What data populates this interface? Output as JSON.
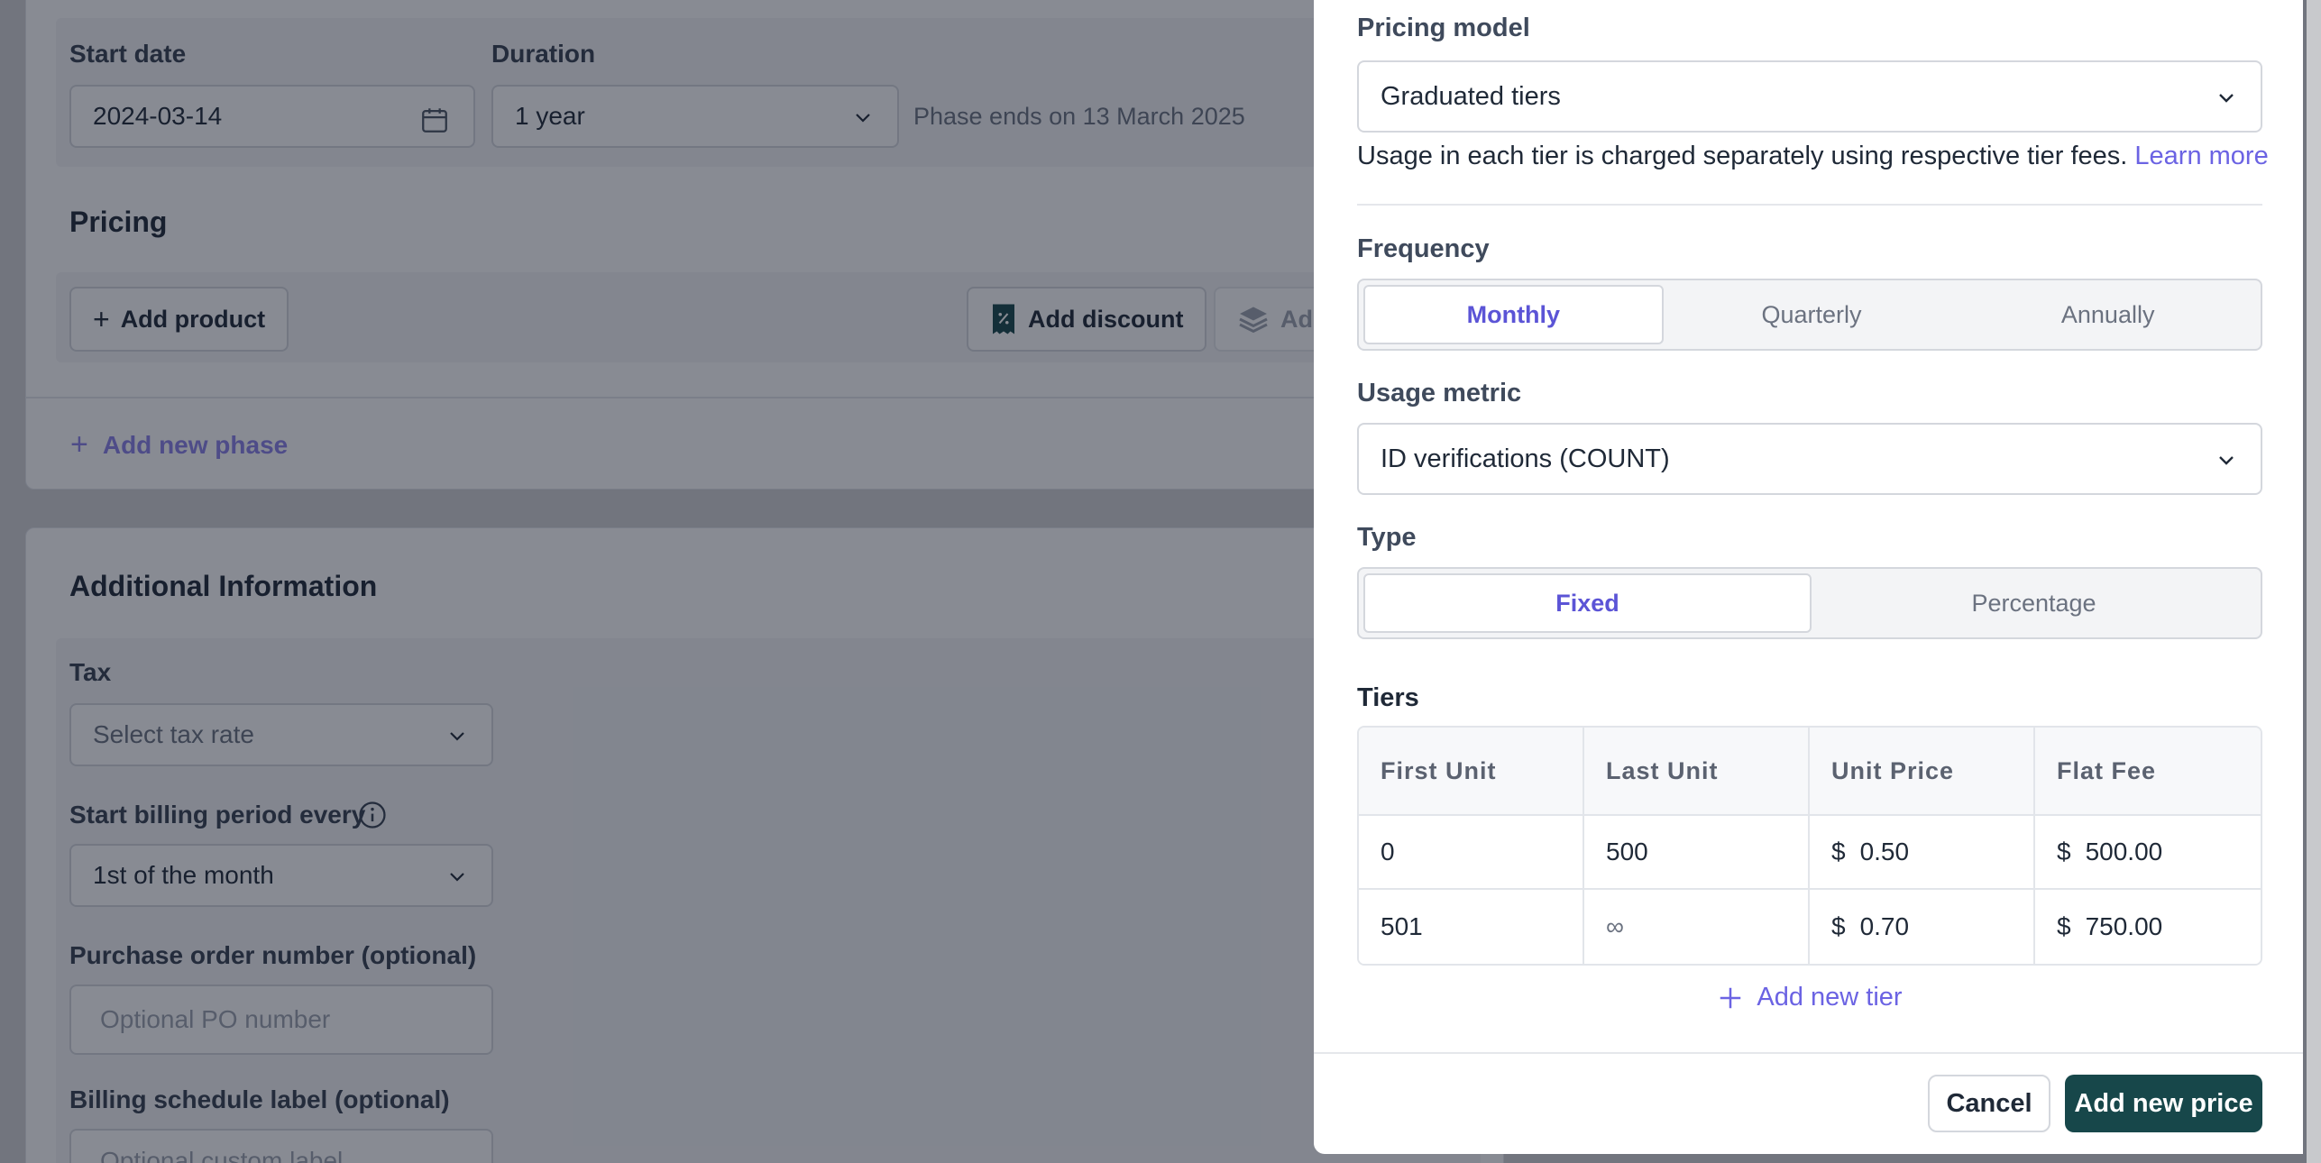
{
  "background": {
    "phase": {
      "start_date_label": "Start date",
      "start_date_value": "2024-03-14",
      "duration_label": "Duration",
      "duration_value": "1 year",
      "phase_end_text": "Phase ends on 13 March 2025"
    },
    "pricing": {
      "title": "Pricing",
      "add_product": "Add product",
      "add_discount": "Add discount",
      "add_other_partial": "Ad"
    },
    "add_new_phase": "Add new phase",
    "additional": {
      "title": "Additional Information",
      "tax_label": "Tax",
      "tax_placeholder": "Select tax rate",
      "billing_period_label": "Start billing period every",
      "billing_period_value": "1st of the month",
      "po_label": "Purchase order number (optional)",
      "po_placeholder": "Optional PO number",
      "schedule_label": "Billing schedule label (optional)",
      "schedule_placeholder": "Optional custom label"
    }
  },
  "drawer": {
    "pricing_model_label": "Pricing model",
    "pricing_model_value": "Graduated tiers",
    "help_text": "Usage in each tier is charged separately using respective tier fees.",
    "learn_more": "Learn more",
    "frequency_label": "Frequency",
    "frequency_options": [
      "Monthly",
      "Quarterly",
      "Annually"
    ],
    "frequency_selected": "Monthly",
    "usage_metric_label": "Usage metric",
    "usage_metric_value": "ID verifications (COUNT)",
    "type_label": "Type",
    "type_options": [
      "Fixed",
      "Percentage"
    ],
    "type_selected": "Fixed",
    "tiers_label": "Tiers",
    "tiers_columns": [
      "First Unit",
      "Last Unit",
      "Unit Price",
      "Flat Fee"
    ],
    "currency_symbol": "$",
    "tiers_rows": [
      {
        "first_unit": "0",
        "last_unit": "500",
        "unit_price": "0.50",
        "flat_fee": "500.00"
      },
      {
        "first_unit": "501",
        "last_unit": "∞",
        "unit_price": "0.70",
        "flat_fee": "750.00"
      }
    ],
    "add_tier": "Add new tier",
    "cancel": "Cancel",
    "submit": "Add new price"
  },
  "colors": {
    "accent": "#6b63e3",
    "primary_button": "#17474a",
    "overlay": "rgba(17,24,39,0.5)"
  }
}
